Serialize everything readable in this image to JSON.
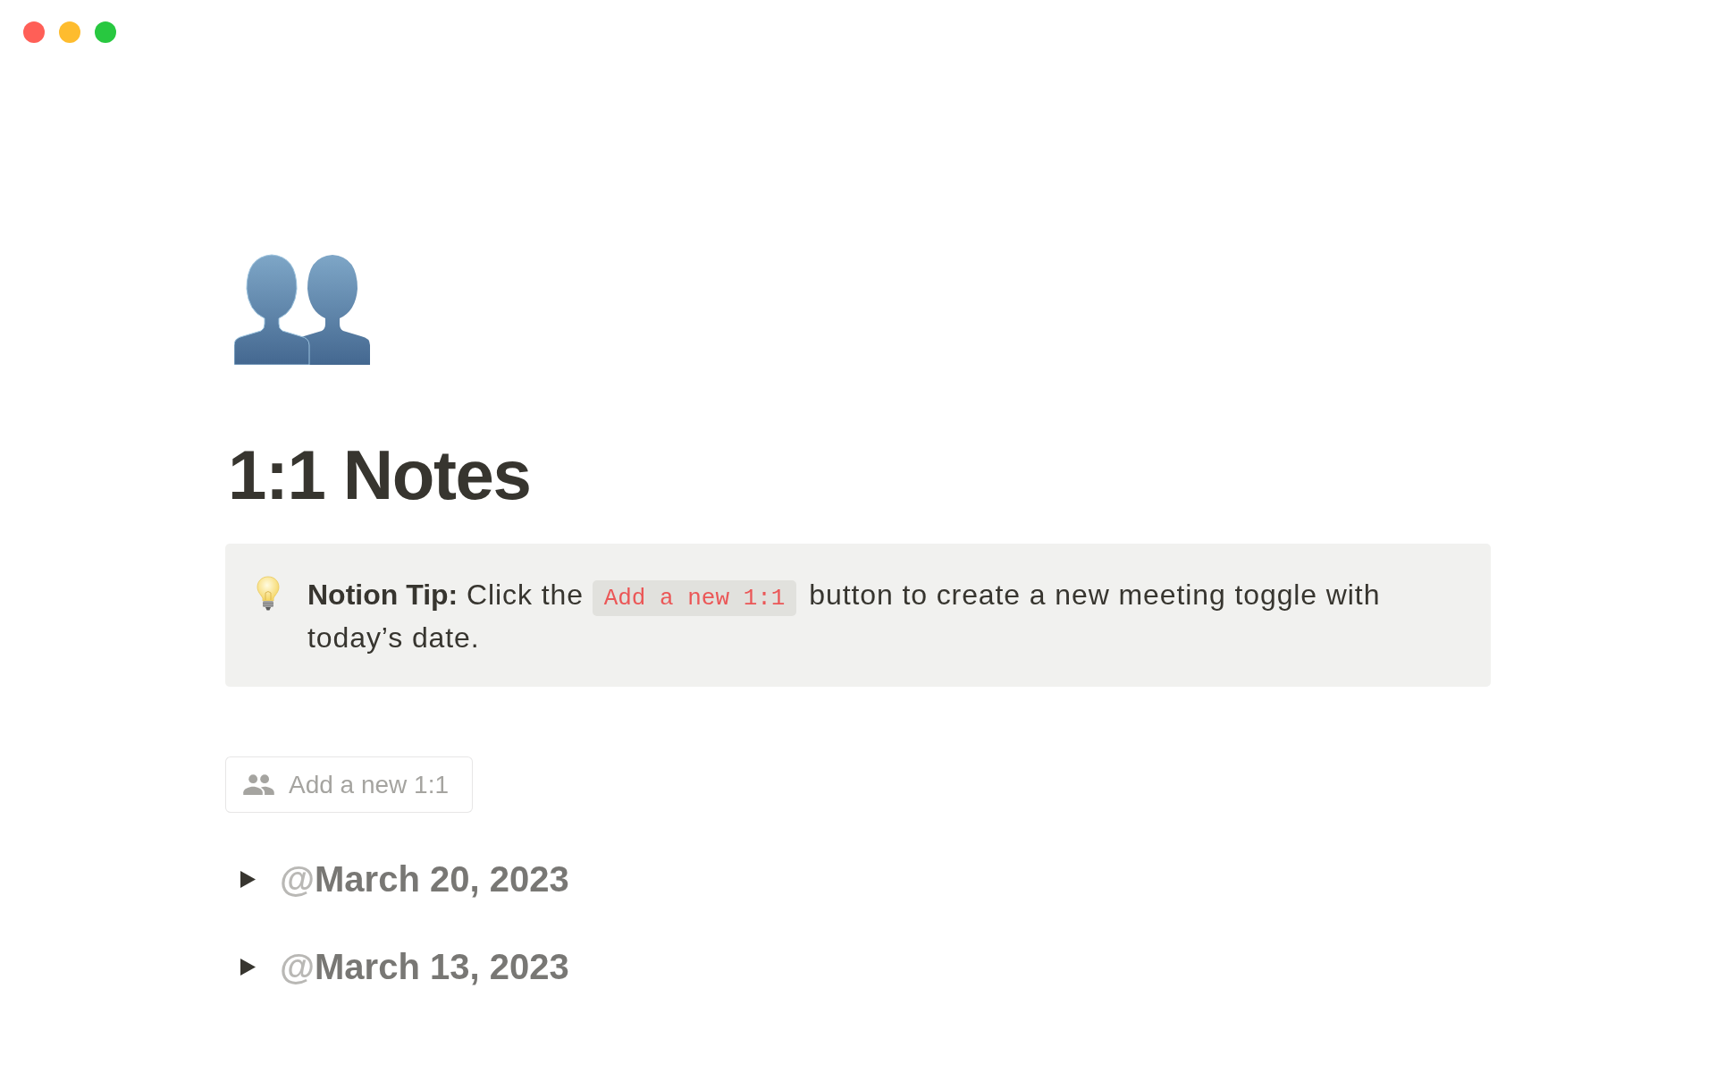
{
  "page": {
    "title": "1:1 Notes",
    "callout": {
      "lead": "**Notion Tip:** Click the",
      "code": "Add a new 1:1",
      "rest": "button to create a new meeting toggle with today’s date."
    },
    "button": {
      "label": "Add a new 1:1"
    },
    "toggles": [
      {
        "at_sign": "@",
        "date": "March 20, 2023",
        "expanded": false
      },
      {
        "at_sign": "@",
        "date": "March 13, 2023",
        "expanded": false
      }
    ]
  }
}
